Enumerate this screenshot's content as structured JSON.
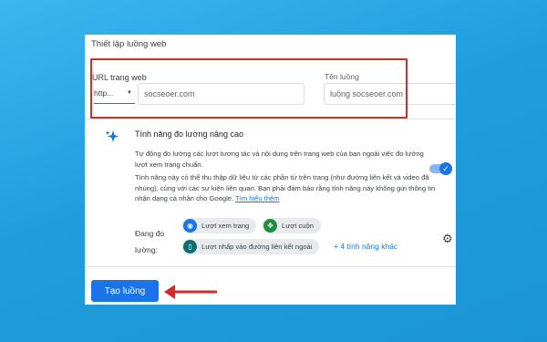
{
  "panel": {
    "title": "Thiết lập luồng web"
  },
  "url_field": {
    "label": "URL trang web",
    "protocol": "http...",
    "value": "socseoer.com"
  },
  "name_field": {
    "label": "Tên luồng",
    "value": "luồng socseoer.com"
  },
  "enhanced": {
    "title": "Tính năng đo lường nâng cao",
    "desc1": "Tự động đo lường các lượt tương tác và nội dung trên trang web của bạn ngoài việc đo lường lượt xem trang chuẩn.",
    "desc2": "Tính năng này có thể thu thập dữ liệu từ các phần tử trên trang (như đường liên kết và video đã nhúng), cùng với các sự kiện liên quan. Bạn phải đảm bảo rằng tính năng này không gửi thông tin nhận dạng cá nhân cho Google.",
    "learn_more": "Tìm hiểu thêm",
    "toggle_on": true,
    "measuring_label": "Đang đo lường:",
    "chips": [
      "Lượt xem trang",
      "Lượt cuộn",
      "Lượt nhấp vào đường liên kết ngoài"
    ],
    "more_features": "+ 4 tính năng khác"
  },
  "create_button": "Tạo luồng",
  "colors": {
    "background": "#22a2e0",
    "accent": "#1a73e8",
    "highlight": "#d52b2b"
  }
}
